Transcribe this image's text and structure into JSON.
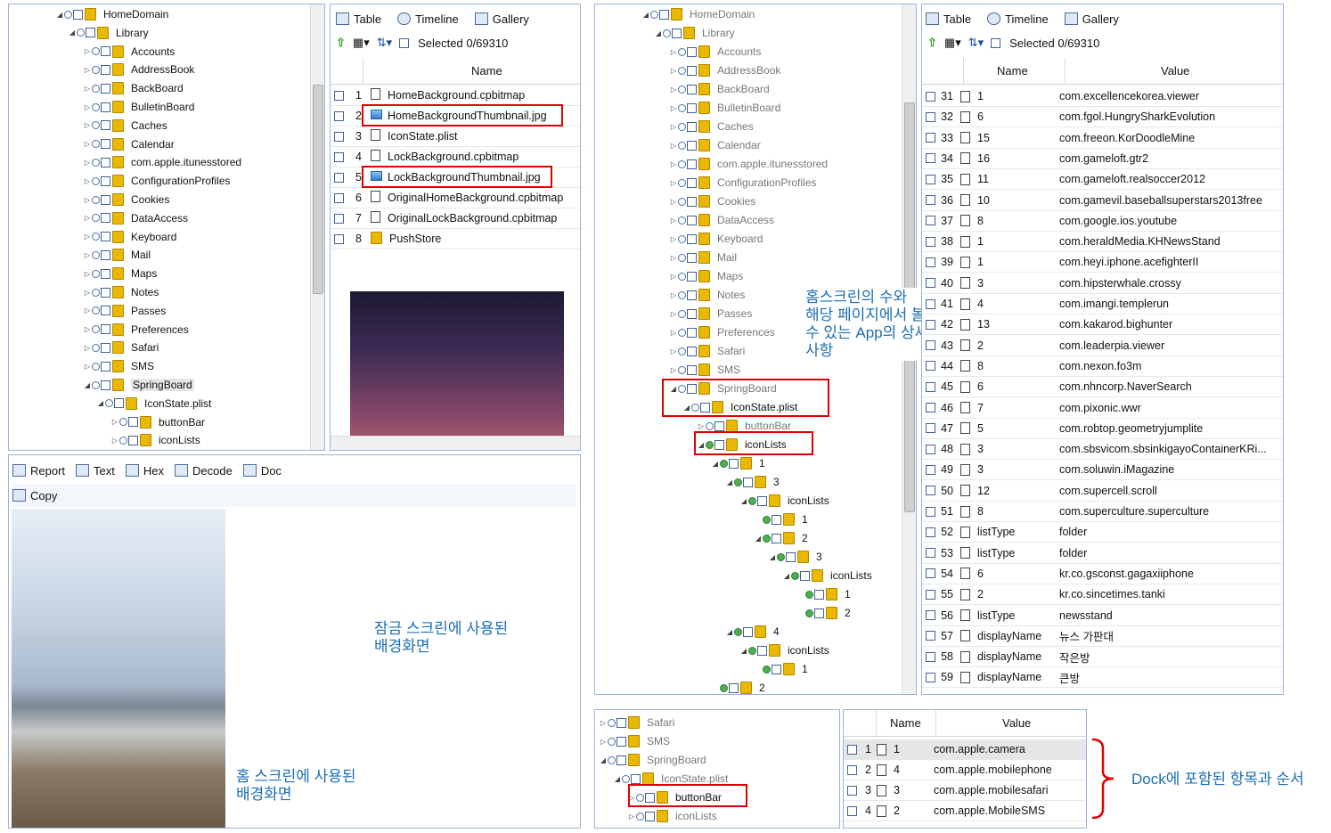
{
  "left_tree": {
    "items": [
      {
        "label": "HomeDomain"
      },
      {
        "label": "Library"
      },
      {
        "label": "Accounts"
      },
      {
        "label": "AddressBook"
      },
      {
        "label": "BackBoard"
      },
      {
        "label": "BulletinBoard"
      },
      {
        "label": "Caches"
      },
      {
        "label": "Calendar"
      },
      {
        "label": "com.apple.itunesstored"
      },
      {
        "label": "ConfigurationProfiles"
      },
      {
        "label": "Cookies"
      },
      {
        "label": "DataAccess"
      },
      {
        "label": "Keyboard"
      },
      {
        "label": "Mail"
      },
      {
        "label": "Maps"
      },
      {
        "label": "Notes"
      },
      {
        "label": "Passes"
      },
      {
        "label": "Preferences"
      },
      {
        "label": "Safari"
      },
      {
        "label": "SMS"
      },
      {
        "label": "SpringBoard"
      },
      {
        "label": "IconState.plist"
      },
      {
        "label": "buttonBar"
      },
      {
        "label": "iconLists"
      }
    ]
  },
  "toolbar": {
    "tab_table": "Table",
    "tab_timeline": "Timeline",
    "tab_gallery": "Gallery",
    "selected": "Selected 0/69310"
  },
  "file_table": {
    "header": "Name",
    "rows": [
      {
        "n": "1",
        "name": "HomeBackground.cpbitmap"
      },
      {
        "n": "2",
        "name": "HomeBackgroundThumbnail.jpg"
      },
      {
        "n": "3",
        "name": "IconState.plist"
      },
      {
        "n": "4",
        "name": "LockBackground.cpbitmap"
      },
      {
        "n": "5",
        "name": "LockBackgroundThumbnail.jpg"
      },
      {
        "n": "6",
        "name": "OriginalHomeBackground.cpbitmap"
      },
      {
        "n": "7",
        "name": "OriginalLockBackground.cpbitmap"
      },
      {
        "n": "8",
        "name": "PushStore"
      }
    ]
  },
  "bottom_toolbar": {
    "report": "Report",
    "text": "Text",
    "hex": "Hex",
    "decode": "Decode",
    "doc": "Doc",
    "copy": "Copy"
  },
  "notes": {
    "lock_line1": "잠금 스크린에 사용된",
    "lock_line2": "배경화면",
    "home_line1": "홈 스크린에 사용된",
    "home_line2": "배경화면",
    "apps_line1": "홈스크린의 수와",
    "apps_line2": "해당 페이지에서 볼",
    "apps_line3": "수 있는 App의 상세",
    "apps_line4": "사항",
    "dock": "Dock에 포함된 항목과 순서"
  },
  "right_tree": {
    "items": [
      {
        "label": "HomeDomain"
      },
      {
        "label": "Library"
      },
      {
        "label": "Accounts"
      },
      {
        "label": "AddressBook"
      },
      {
        "label": "BackBoard"
      },
      {
        "label": "BulletinBoard"
      },
      {
        "label": "Caches"
      },
      {
        "label": "Calendar"
      },
      {
        "label": "com.apple.itunesstored"
      },
      {
        "label": "ConfigurationProfiles"
      },
      {
        "label": "Cookies"
      },
      {
        "label": "DataAccess"
      },
      {
        "label": "Keyboard"
      },
      {
        "label": "Mail"
      },
      {
        "label": "Maps"
      },
      {
        "label": "Notes"
      },
      {
        "label": "Passes"
      },
      {
        "label": "Preferences"
      },
      {
        "label": "Safari"
      },
      {
        "label": "SMS"
      },
      {
        "label": "SpringBoard"
      },
      {
        "label": "IconState.plist"
      },
      {
        "label": "buttonBar"
      },
      {
        "label": "iconLists"
      },
      {
        "label": "1"
      },
      {
        "label": "3"
      },
      {
        "label": "iconLists"
      },
      {
        "label": "1"
      },
      {
        "label": "2"
      },
      {
        "label": "3"
      },
      {
        "label": "iconLists"
      },
      {
        "label": "1"
      },
      {
        "label": "2"
      },
      {
        "label": "4"
      },
      {
        "label": "iconLists"
      },
      {
        "label": "1"
      },
      {
        "label": "2"
      }
    ]
  },
  "value_table": {
    "col_name": "Name",
    "col_value": "Value",
    "rows": [
      {
        "n": "31",
        "name": "1",
        "value": "com.excellencekorea.viewer"
      },
      {
        "n": "32",
        "name": "6",
        "value": "com.fgol.HungrySharkEvolution"
      },
      {
        "n": "33",
        "name": "15",
        "value": "com.freeon.KorDoodleMine"
      },
      {
        "n": "34",
        "name": "16",
        "value": "com.gameloft.gtr2"
      },
      {
        "n": "35",
        "name": "11",
        "value": "com.gameloft.realsoccer2012"
      },
      {
        "n": "36",
        "name": "10",
        "value": "com.gamevil.baseballsuperstars2013free"
      },
      {
        "n": "37",
        "name": "8",
        "value": "com.google.ios.youtube"
      },
      {
        "n": "38",
        "name": "1",
        "value": "com.heraldMedia.KHNewsStand"
      },
      {
        "n": "39",
        "name": "1",
        "value": "com.heyi.iphone.acefighterII"
      },
      {
        "n": "40",
        "name": "3",
        "value": "com.hipsterwhale.crossy"
      },
      {
        "n": "41",
        "name": "4",
        "value": "com.imangi.templerun"
      },
      {
        "n": "42",
        "name": "13",
        "value": "com.kakarod.bighunter"
      },
      {
        "n": "43",
        "name": "2",
        "value": "com.leaderpia.viewer"
      },
      {
        "n": "44",
        "name": "8",
        "value": "com.nexon.fo3m"
      },
      {
        "n": "45",
        "name": "6",
        "value": "com.nhncorp.NaverSearch"
      },
      {
        "n": "46",
        "name": "7",
        "value": "com.pixonic.wwr"
      },
      {
        "n": "47",
        "name": "5",
        "value": "com.robtop.geometryjumplite"
      },
      {
        "n": "48",
        "name": "3",
        "value": "com.sbsvicom.sbsinkigayoContainerKRi..."
      },
      {
        "n": "49",
        "name": "3",
        "value": "com.soluwin.iMagazine"
      },
      {
        "n": "50",
        "name": "12",
        "value": "com.supercell.scroll"
      },
      {
        "n": "51",
        "name": "8",
        "value": "com.superculture.superculture"
      },
      {
        "n": "52",
        "name": "listType",
        "value": "folder"
      },
      {
        "n": "53",
        "name": "listType",
        "value": "folder"
      },
      {
        "n": "54",
        "name": "6",
        "value": "kr.co.gsconst.gagaxiiphone"
      },
      {
        "n": "55",
        "name": "2",
        "value": "kr.co.sincetimes.tanki"
      },
      {
        "n": "56",
        "name": "listType",
        "value": "newsstand"
      },
      {
        "n": "57",
        "name": "displayName",
        "value": "뉴스 가판대"
      },
      {
        "n": "58",
        "name": "displayName",
        "value": "작은방"
      },
      {
        "n": "59",
        "name": "displayName",
        "value": "큰방"
      }
    ]
  },
  "dock_tree": {
    "items": [
      {
        "label": "Safari"
      },
      {
        "label": "SMS"
      },
      {
        "label": "SpringBoard"
      },
      {
        "label": "IconState.plist"
      },
      {
        "label": "buttonBar"
      },
      {
        "label": "iconLists"
      }
    ]
  },
  "dock_table": {
    "col_name": "Name",
    "col_value": "Value",
    "rows": [
      {
        "n": "1",
        "name": "1",
        "value": "com.apple.camera"
      },
      {
        "n": "2",
        "name": "4",
        "value": "com.apple.mobilephone"
      },
      {
        "n": "3",
        "name": "3",
        "value": "com.apple.mobilesafari"
      },
      {
        "n": "4",
        "name": "2",
        "value": "com.apple.MobileSMS"
      }
    ]
  }
}
